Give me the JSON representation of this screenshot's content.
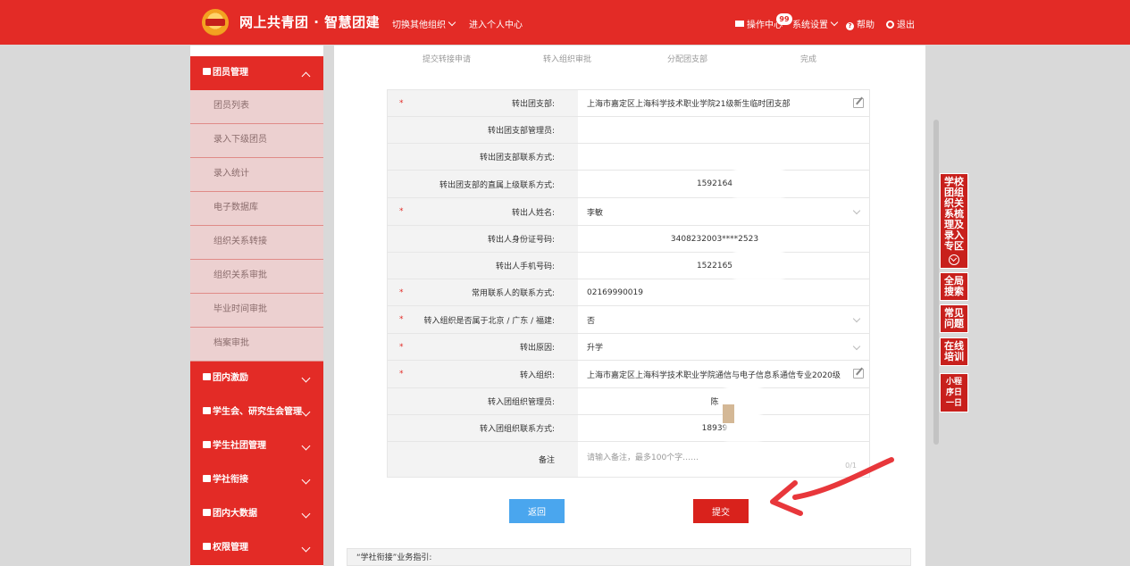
{
  "header": {
    "brand": "网上共青团 · 智慧团建",
    "switch_org": "切换其他组织",
    "personal_center": "进入个人中心",
    "operations": "操作中心",
    "badge_count": "99",
    "settings": "系统设置",
    "help": "帮助",
    "logout": "退出",
    "brand_color": "#e32b26"
  },
  "sidebar": {
    "active_section": "团员管理",
    "sub_items": [
      "团员列表",
      "录入下级团员",
      "录入统计",
      "电子数据库",
      "组织关系转接",
      "组织关系审批",
      "毕业时间审批",
      "档案审批"
    ],
    "sections": [
      "团内激励",
      "学生会、研究生会管理",
      "学生社团管理",
      "学社衔接",
      "团内大数据",
      "权限管理"
    ]
  },
  "steps": [
    "提交转接申请",
    "转入组织审批",
    "分配团支部",
    "完成"
  ],
  "form": {
    "rows": [
      {
        "label": "转出团支部:",
        "value": "上海市嘉定区上海科学技术职业学院21级新生临时团支部"
      },
      {
        "label": "转出团支部管理员:",
        "value": ""
      },
      {
        "label": "转出团支部联系方式:",
        "value": ""
      },
      {
        "label": "转出团支部的直属上级联系方式:",
        "value": "1592164"
      },
      {
        "label": "转出人姓名:",
        "value": "李敏"
      },
      {
        "label": "转出人身份证号码:",
        "value": "3408232003****2523"
      },
      {
        "label": "转出人手机号码:",
        "value": "1522165"
      },
      {
        "label": "常用联系人的联系方式:",
        "value": "02169990019"
      },
      {
        "label": "转入组织是否属于北京 / 广东 / 福建:",
        "value": "否"
      },
      {
        "label": "转出原因:",
        "value": "升学"
      },
      {
        "label": "转入组织:",
        "value": "上海市嘉定区上海科学技术职业学院通信与电子信息系通信专业2020级"
      },
      {
        "label": "转入团组织管理员:",
        "value": "陈"
      },
      {
        "label": "转入团组织联系方式:",
        "value": "18939"
      },
      {
        "label": "备注",
        "value": "请输入备注，最多100个字……"
      }
    ],
    "required_mark": "*",
    "remark_counter": "0/1"
  },
  "buttons": {
    "back": "返回",
    "submit": "提交"
  },
  "guide": "“学社衔接”业务指引:",
  "right_tabs": [
    "学校团组织关系梳理及录入专区",
    "全局搜索",
    "常见问题",
    "在线培训",
    "小程序日一日"
  ]
}
